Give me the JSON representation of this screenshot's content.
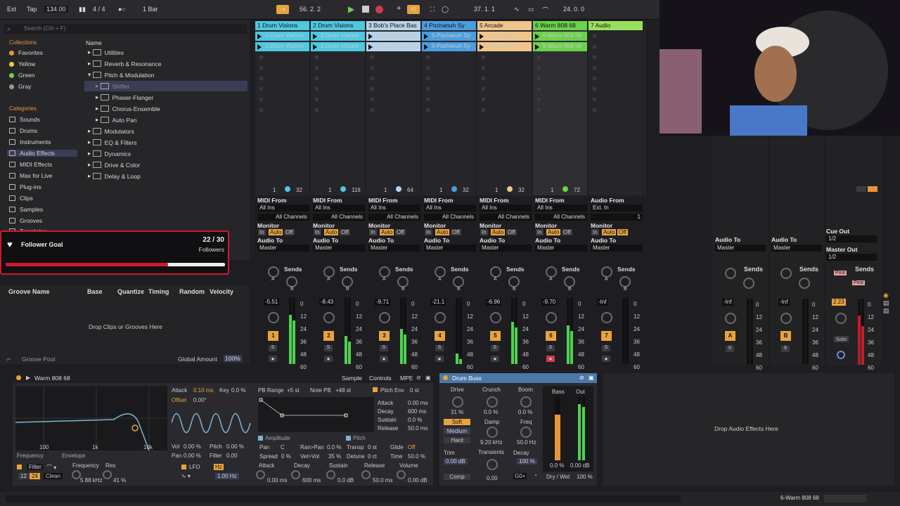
{
  "toolbar": {
    "ext": "Ext",
    "tap": "Tap",
    "tempo": "134.00",
    "sig": "4 / 4",
    "quant": "1 Bar",
    "pos1": "56.  2.  2",
    "pos2": "37.  1.  1",
    "pos3": "24.  0.  0"
  },
  "browser": {
    "search": "Search (Ctrl + F)",
    "collections": "Collections",
    "categories": "Categories",
    "name_header": "Name",
    "coll": [
      {
        "label": "Favorites",
        "color": "#e8953a"
      },
      {
        "label": "Yellow",
        "color": "#e6d23c"
      },
      {
        "label": "Green",
        "color": "#6ad24a"
      },
      {
        "label": "Gray",
        "color": "#9a9a9a"
      }
    ],
    "cats": [
      "Sounds",
      "Drums",
      "Instruments",
      "Audio Effects",
      "MIDI Effects",
      "Max for Live",
      "Plug-ins",
      "Clips",
      "Samples",
      "Grooves",
      "Templates"
    ],
    "tree": [
      "Utilities",
      "Reverb & Resonance",
      "Pitch & Modulation",
      "Shifter",
      "Phaser-Flanger",
      "Chorus-Ensemble",
      "Auto Pan",
      "Modulators",
      "EQ & Filters",
      "Dynamics",
      "Drive & Color",
      "Delay & Loop"
    ]
  },
  "follower": {
    "title": "Follower Goal",
    "count": "22 / 30",
    "label": "Followers",
    "progress": 0.74
  },
  "groove": {
    "cols": [
      "Groove Name",
      "Base",
      "Quantize",
      "Timing",
      "Random",
      "Velocity"
    ],
    "drop": "Drop Clips or Grooves Here",
    "pool": "Groove Pool",
    "global": "Global Amount",
    "amount": "100%"
  },
  "tracks": [
    {
      "name": "1 Drum Visions",
      "color": "#4fc8e0",
      "clips": [
        "1-Drum Visions",
        "1-Drum Visions"
      ],
      "n1": "1",
      "n2": "32",
      "from": "MIDI From",
      "src": "All Ins",
      "sub": "All Channels",
      "vol": "-5.51",
      "num": "1"
    },
    {
      "name": "2 Drum Visions",
      "color": "#4fc8e0",
      "clips": [
        "2-Drum Visions",
        "2-Drum Visions"
      ],
      "n1": "1",
      "n2": "116",
      "from": "MIDI From",
      "src": "All Ins",
      "sub": "All Channels",
      "vol": "-8.43",
      "num": "2"
    },
    {
      "name": "3 Bob's Place Bas",
      "color": "#b8d2e8",
      "clips": [
        "3-Bob's Place B",
        "3-Bob's Place B"
      ],
      "n1": "1",
      "n2": "64",
      "from": "MIDI From",
      "src": "All Ins",
      "sub": "All Channels",
      "vol": "-9.71",
      "num": "3"
    },
    {
      "name": "4 Pochanuh Sy",
      "color": "#4a9ee0",
      "clips": [
        "5-Pochanuh Sy",
        "5-Pochanuh Sy"
      ],
      "n1": "1",
      "n2": "32",
      "from": "MIDI From",
      "src": "All Ins",
      "sub": "All Channels",
      "vol": "-21.1",
      "num": "4"
    },
    {
      "name": "5 Arcade",
      "color": "#f0c48a",
      "clips": [
        "5-Arcade 4",
        "5-Arcade 5"
      ],
      "n1": "1",
      "n2": "32",
      "from": "MIDI From",
      "src": "All Ins",
      "sub": "All Channels",
      "vol": "-6.96",
      "num": "5"
    },
    {
      "name": "6 Warm 808 68",
      "color": "#6ad24a",
      "clips": [
        "6-Warm 808 68",
        "6-Warm 808 68"
      ],
      "n1": "1",
      "n2": "72",
      "from": "MIDI From",
      "src": "All Ins",
      "sub": "All Channels",
      "vol": "-9.70",
      "num": "6"
    },
    {
      "name": "7 Audio",
      "color": "#9ae060",
      "clips": [],
      "n1": "",
      "n2": "",
      "from": "Audio From",
      "src": "Ext. In",
      "sub": "1",
      "vol": "-Inf",
      "num": "7"
    }
  ],
  "mixer": {
    "monitor": "Monitor",
    "in": "In",
    "auto": "Auto",
    "off": "Off",
    "audio_to": "Audio To",
    "master": "Master",
    "sends": "Sends",
    "a": "A",
    "b": "B",
    "s": "S",
    "cue": "Cue Out",
    "cue_val": "1/2",
    "master_out": "Master Out",
    "mo_val": "1/2",
    "post": "Post",
    "ret_a": "A",
    "ret_b": "B",
    "master_vol": "2.23",
    "solo": "Solo",
    "inf": "-Inf"
  },
  "meter_ticks": [
    "0",
    "12",
    "24",
    "36",
    "48",
    "60"
  ],
  "device": {
    "title": "Warm 808 68",
    "tabs": [
      "Sample",
      "Controls",
      "MPE"
    ],
    "attack": "Attack",
    "attack_v": "0.10 ms",
    "key": "Key",
    "key_v": "0.0 %",
    "offset": "Offset",
    "offset_v": "0.00°",
    "pbrange": "PB Range",
    "pbrange_v": "+5 st",
    "notepb": "Note PB",
    "notepb_v": "+48 st",
    "pitch_env": "Pitch Env",
    "pitch_env_v": "0 st",
    "env": [
      [
        "Attack",
        "0.00 ms"
      ],
      [
        "Decay",
        "600 ms"
      ],
      [
        "Sustain",
        "0.0 %"
      ],
      [
        "Release",
        "50.0 ms"
      ]
    ],
    "freq": "Frequency",
    "envelope": "Envelope",
    "x100": "100",
    "x1k": "1k",
    "x10k": "10k",
    "vol": "Vol",
    "vol_v": "0.00 %",
    "pitch": "Pitch",
    "pitch_v": "0.00 %",
    "pan": "Pan",
    "pan_v": "0.00 %",
    "filter": "Filter",
    "filter_v": "0.00",
    "amplitude": "Amplitude",
    "pitch2": "Pitch",
    "pan2": "Pan",
    "c": "C",
    "ranpan": "Ran>Pan",
    "ranpan_v": "0.0 %",
    "transp": "Transp",
    "transp_v": "0 st",
    "glide": "Glide",
    "glide_v": "Off",
    "spread": "Spread",
    "spread_v": "0 %",
    "velvol": "Vel>Vol",
    "velvol_v": "35 %",
    "detune": "Detune",
    "detune_v": "0 ct",
    "time": "Time",
    "time_v": "50.0 %",
    "filter_lbl": "Filter",
    "f12": "12",
    "f24": "24",
    "clean": "Clean",
    "frequency": "Frequency",
    "res": "Res",
    "freq_v": "5.88 kHz",
    "res_v": "41 %",
    "lfo": "LFO",
    "hz": "Hz",
    "hz_v": "1.00 Hz",
    "bottom": [
      [
        "Attack",
        "0.00 ms"
      ],
      [
        "Decay",
        "600 ms"
      ],
      [
        "Sustain",
        "0.0 dB"
      ],
      [
        "Release",
        "50.0 ms"
      ],
      [
        "Volume",
        "0.00 dB"
      ]
    ]
  },
  "buss": {
    "title": "Drum Buss",
    "drive": "Drive",
    "drive_v": "31 %",
    "crunch": "Crunch",
    "crunch_v": "0.0 %",
    "boom": "Boom",
    "boom_v": "0.0 %",
    "soft": "Soft",
    "medium": "Medium",
    "hard": "Hard",
    "damp": "Damp",
    "damp_v": "9.20 kHz",
    "freq": "Freq",
    "freq_v": "50.0 Hz",
    "trim": "Trim",
    "trim_v": "0.00 dB",
    "transients": "Transients",
    "transients_v": "0.00",
    "decay": "Decay",
    "decay_v": "100 %",
    "comp": "Comp",
    "bass": "Bass",
    "out": "Out",
    "bass_v": "0.0 %",
    "out_v": "0.00 dB",
    "g0": "G0+",
    "drywet": "Dry / Wet",
    "drywet_v": "100 %"
  },
  "drop_fx": "Drop Audio Effects Here",
  "status": {
    "track": "6-Warm 808 68"
  }
}
